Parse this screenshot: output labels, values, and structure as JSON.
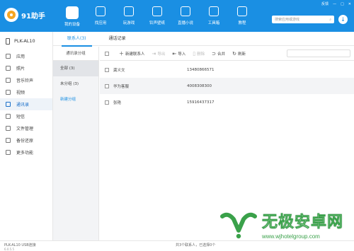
{
  "app": {
    "name": "91助手"
  },
  "window": {
    "feedback": "反馈",
    "minimize": "—",
    "maximize": "□",
    "close": "✕"
  },
  "nav": {
    "tabs": [
      {
        "label": "我的设备",
        "icon": "device-icon",
        "active": true
      },
      {
        "label": "找应用",
        "icon": "app-store-icon"
      },
      {
        "label": "玩游戏",
        "icon": "gamepad-icon"
      },
      {
        "label": "铃声壁纸",
        "icon": "image-icon"
      },
      {
        "label": "直播小说",
        "icon": "play-icon"
      },
      {
        "label": "工具箱",
        "icon": "toolbox-icon"
      },
      {
        "label": "教程",
        "icon": "book-icon"
      }
    ],
    "search_placeholder": "搜索应用或游戏"
  },
  "sidebar": {
    "device": "PLK-AL10",
    "items": [
      {
        "label": "应用",
        "icon": "apps-icon"
      },
      {
        "label": "照片",
        "icon": "photo-icon"
      },
      {
        "label": "音乐铃声",
        "icon": "music-icon"
      },
      {
        "label": "视频",
        "icon": "video-icon"
      },
      {
        "label": "通讯录",
        "icon": "contacts-icon",
        "active": true
      },
      {
        "label": "短信",
        "icon": "sms-icon"
      },
      {
        "label": "文件管理",
        "icon": "folder-icon"
      },
      {
        "label": "备份还原",
        "icon": "backup-icon"
      },
      {
        "label": "更多功能",
        "icon": "more-icon"
      }
    ]
  },
  "contact_tabs": [
    {
      "label": "联系人(3)",
      "active": true
    },
    {
      "label": "通话记录"
    }
  ],
  "groups": {
    "header": "通讯录分组",
    "items": [
      {
        "label": "全部 (3)",
        "active": true
      },
      {
        "label": "未分组 (3)"
      }
    ],
    "new_group": "新建分组"
  },
  "toolbar": {
    "new_contact": "新建联系人",
    "export": "导出",
    "import": "导入",
    "delete": "删除",
    "merge": "合并",
    "refresh": "刷新"
  },
  "contacts": [
    {
      "name": "龚义文",
      "phone": "13480866571"
    },
    {
      "name": "华为客服",
      "phone": "4008308300"
    },
    {
      "name": "张艳",
      "phone": "15916437317"
    }
  ],
  "status": {
    "device": "PLK-AL10  USB连接",
    "selection": "共3个联系人，已选择0个",
    "version": "6.0.5.5"
  },
  "watermark": {
    "brand": "无极安卓网",
    "url": "www.wjhotelgroup.com"
  },
  "colors": {
    "primary": "#1a8fe3",
    "watermark": "#3aa14a"
  }
}
